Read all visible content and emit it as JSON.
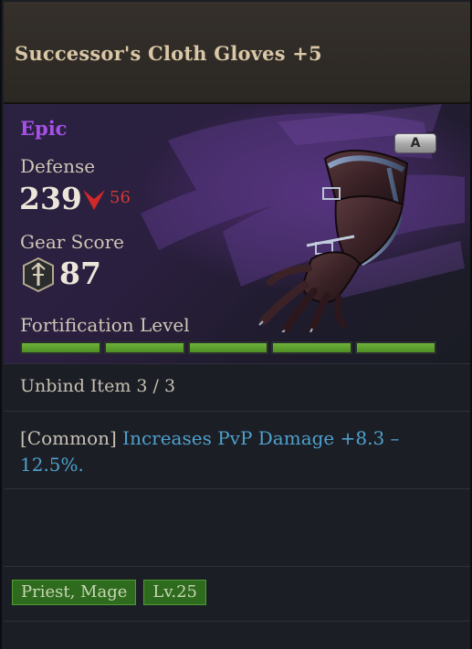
{
  "item": {
    "name": "Successor's Cloth Gloves +5",
    "rarity": "Epic",
    "rarity_color": "#a650e6",
    "grade": "A",
    "icon": "cloth-gloves-icon"
  },
  "stats": {
    "defense_label": "Defense",
    "defense_value": "239",
    "defense_diff": "56",
    "defense_diff_icon": "decrease-arrow-icon",
    "gear_score_label": "Gear Score",
    "gear_score_value": "87",
    "gear_score_icon": "gear-score-sword-icon"
  },
  "fortification": {
    "label": "Fortification Level",
    "segments_total": 5,
    "segments_filled": 5,
    "fill_color": "#5ea22f"
  },
  "unbind": {
    "text": "Unbind Item 3 / 3"
  },
  "effect": {
    "prefix": "[Common]",
    "text": "Increases PvP Damage +8.3 – 12.5%.",
    "text_color": "#4fa1cd"
  },
  "requirements": {
    "classes": "Priest, Mage",
    "level": "Lv.25",
    "tag_color": "#2f6b1f"
  }
}
